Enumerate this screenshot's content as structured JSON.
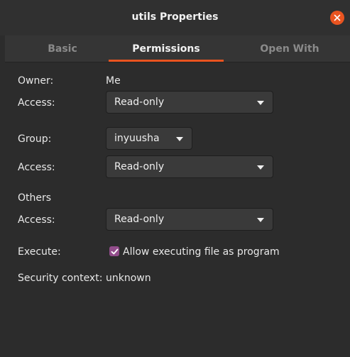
{
  "window": {
    "title": "utils Properties"
  },
  "tabs": [
    {
      "label": "Basic",
      "active": false
    },
    {
      "label": "Permissions",
      "active": true
    },
    {
      "label": "Open With",
      "active": false
    }
  ],
  "owner": {
    "label": "Owner:",
    "value": "Me"
  },
  "owner_access": {
    "label": "Access:",
    "selected": "Read-only"
  },
  "group": {
    "label": "Group:",
    "selected": "inyuusha"
  },
  "group_access": {
    "label": "Access:",
    "selected": "Read-only"
  },
  "others": {
    "heading": "Others"
  },
  "others_access": {
    "label": "Access:",
    "selected": "Read-only"
  },
  "execute": {
    "label": "Execute:",
    "checkbox_label": "Allow executing file as program",
    "checked": true
  },
  "security": {
    "label": "Security context:",
    "value": "unknown"
  },
  "colors": {
    "accent": "#e95420",
    "checkbox": "#924d8b",
    "background": "#2c2c2c"
  }
}
